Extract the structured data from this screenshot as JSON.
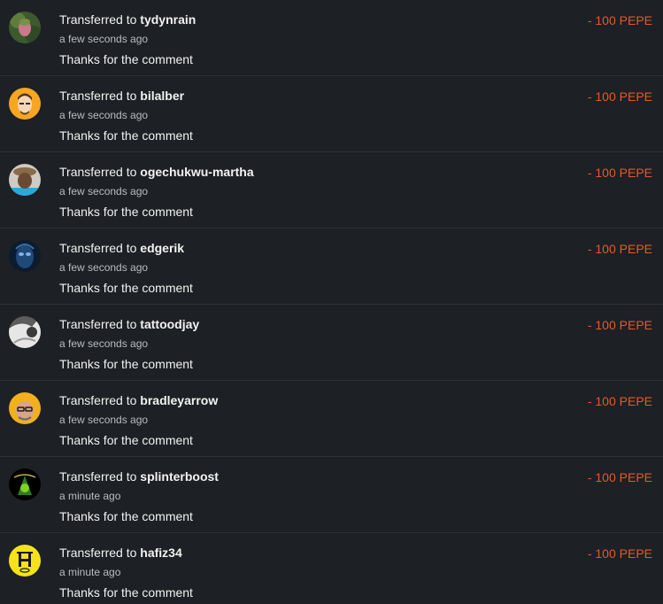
{
  "accent_color": "#e8582a",
  "transfers": [
    {
      "prefix": "Transferred to",
      "user": "tydynrain",
      "time": "a few seconds ago",
      "memo": "Thanks for the comment",
      "amount": "- 100 PEPE",
      "avatar_icon": "avatar-tydynrain-icon"
    },
    {
      "prefix": "Transferred to",
      "user": "bilalber",
      "time": "a few seconds ago",
      "memo": "Thanks for the comment",
      "amount": "- 100 PEPE",
      "avatar_icon": "avatar-bilalber-icon"
    },
    {
      "prefix": "Transferred to",
      "user": "ogechukwu-martha",
      "time": "a few seconds ago",
      "memo": "Thanks for the comment",
      "amount": "- 100 PEPE",
      "avatar_icon": "avatar-ogechukwu-martha-icon"
    },
    {
      "prefix": "Transferred to",
      "user": "edgerik",
      "time": "a few seconds ago",
      "memo": "Thanks for the comment",
      "amount": "- 100 PEPE",
      "avatar_icon": "avatar-edgerik-icon"
    },
    {
      "prefix": "Transferred to",
      "user": "tattoodjay",
      "time": "a few seconds ago",
      "memo": "Thanks for the comment",
      "amount": "- 100 PEPE",
      "avatar_icon": "avatar-tattoodjay-icon"
    },
    {
      "prefix": "Transferred to",
      "user": "bradleyarrow",
      "time": "a few seconds ago",
      "memo": "Thanks for the comment",
      "amount": "- 100 PEPE",
      "avatar_icon": "avatar-bradleyarrow-icon"
    },
    {
      "prefix": "Transferred to",
      "user": "splinterboost",
      "time": "a minute ago",
      "memo": "Thanks for the comment",
      "amount": "- 100 PEPE",
      "avatar_icon": "avatar-splinterboost-icon"
    },
    {
      "prefix": "Transferred to",
      "user": "hafiz34",
      "time": "a minute ago",
      "memo": "Thanks for the comment",
      "amount": "- 100 PEPE",
      "avatar_icon": "avatar-hafiz34-icon"
    }
  ]
}
